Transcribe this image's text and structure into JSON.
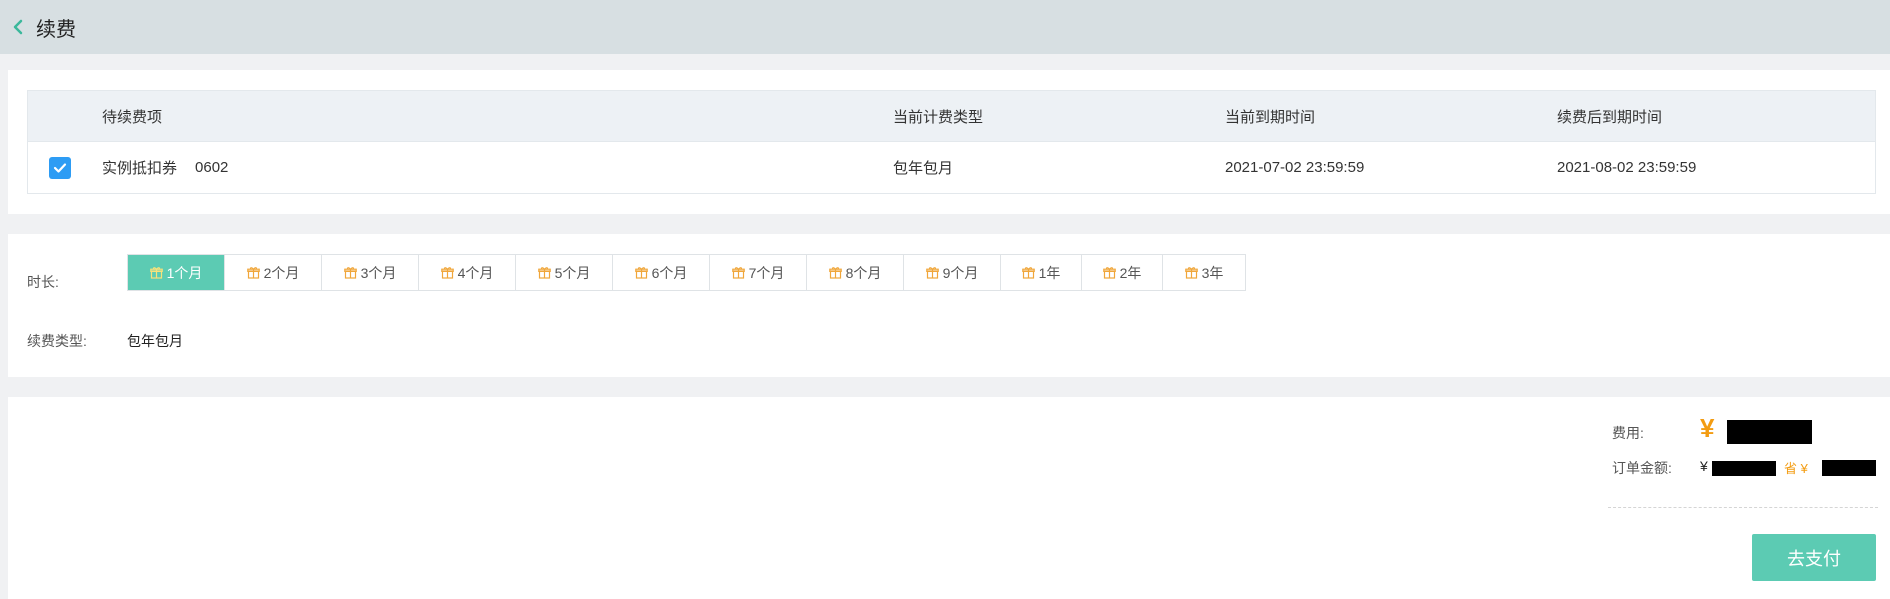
{
  "header": {
    "title": "续费",
    "back_icon": "chevron-left-icon"
  },
  "items": {
    "columns": [
      "待续费项",
      "当前计费类型",
      "当前到期时间",
      "续费后到期时间"
    ],
    "rows": [
      {
        "checked": true,
        "name": "实例抵扣券",
        "code": "0602",
        "billing_type": "包年包月",
        "current_expiry": "2021-07-02 23:59:59",
        "new_expiry": "2021-08-02 23:59:59"
      }
    ]
  },
  "duration": {
    "label": "时长:",
    "options": [
      "1个月",
      "2个月",
      "3个月",
      "4个月",
      "5个月",
      "6个月",
      "7个月",
      "8个月",
      "9个月",
      "1年",
      "2年",
      "3年"
    ],
    "selected": "1个月",
    "option_icon": "gift-icon"
  },
  "renew_type": {
    "label": "续费类型:",
    "value": "包年包月"
  },
  "payment": {
    "fee_label": "费用:",
    "currency": "¥",
    "order_label": "订单金额:",
    "order_currency": "¥",
    "save_prefix": "省 ¥",
    "pay_button": "去支付"
  },
  "colors": {
    "accent": "#5ccbb3",
    "checkbox": "#2d9cf4",
    "price": "#f39c12",
    "header_bg": "#d7dfe2"
  }
}
